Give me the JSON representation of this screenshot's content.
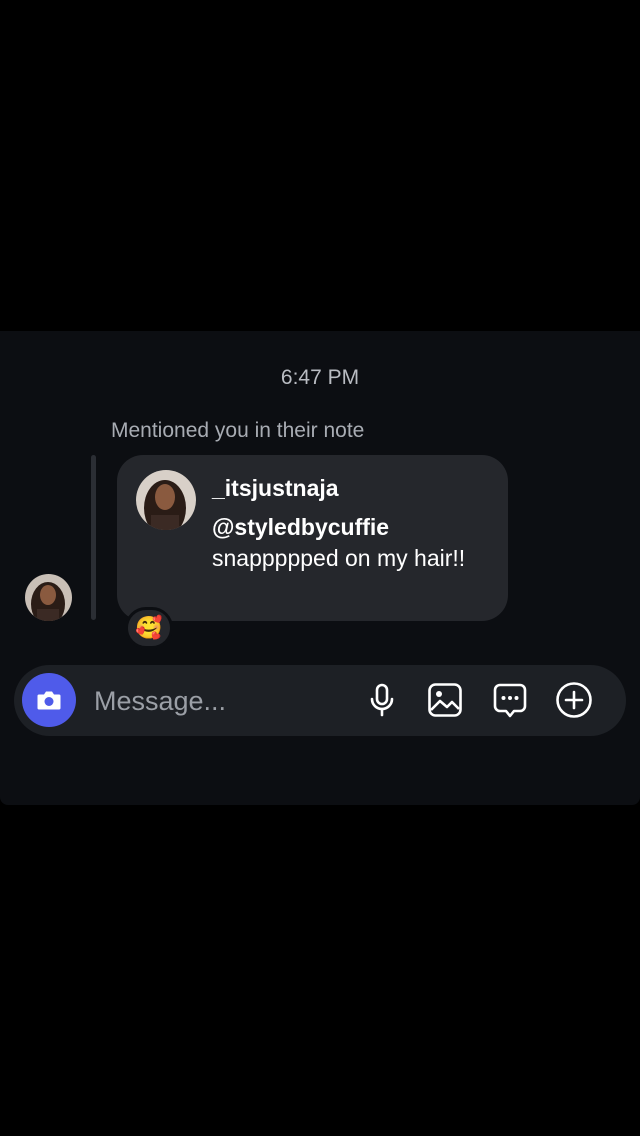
{
  "chat": {
    "timestamp": "6:47 PM",
    "mention_label": "Mentioned you in their note",
    "note": {
      "username": "_itsjustnaja",
      "mention": "@styledbycuffie",
      "text": "snappppped on my hair!!"
    },
    "reaction_emoji": "🥰"
  },
  "composer": {
    "placeholder": "Message...",
    "icons": [
      "camera-icon",
      "microphone-icon",
      "gallery-icon",
      "sticker-icon",
      "plus-circle-icon"
    ]
  },
  "colors": {
    "accent": "#4f5bea",
    "panel_bg": "#0c0e12",
    "bubble_bg": "#25272c",
    "composer_bg": "#1d2025"
  }
}
